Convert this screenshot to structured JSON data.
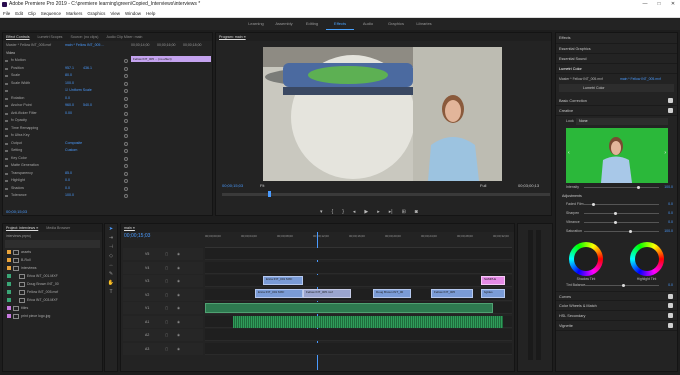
{
  "app": {
    "title": "Adobe Premiere Pro 2019 - C:\\premiere learning\\green\\Copied_Interviews\\interviews *",
    "win_min": "—",
    "win_max": "□",
    "win_close": "✕"
  },
  "menu": [
    "File",
    "Edit",
    "Clip",
    "Sequence",
    "Markers",
    "Graphics",
    "View",
    "Window",
    "Help"
  ],
  "workspaces": [
    {
      "label": "Learning"
    },
    {
      "label": "Assembly"
    },
    {
      "label": "Editing"
    },
    {
      "label": "Effects",
      "active": true
    },
    {
      "label": "Audio"
    },
    {
      "label": "Graphics"
    },
    {
      "label": "Libraries"
    }
  ],
  "effect_controls": {
    "tabs": [
      "Effect Controls",
      "Lumetri Scopes",
      "Source: (no clips)",
      "Audio Clip Mixer: main"
    ],
    "master": "Master * Fellow INT_005.mxf",
    "clip": "main * Fellow INT_005 ...",
    "timecodes": [
      "00;00;14;00",
      "00;00;16;00",
      "00;00;18;00"
    ],
    "clip_bar": "Fellow INT_005 ... (no effect)",
    "section_video": "Video",
    "rows": [
      {
        "label": "fx Motion",
        "indent": 0
      },
      {
        "label": "Position",
        "v": "957.1",
        "v2": "436.1"
      },
      {
        "label": "Scale",
        "v": "80.0"
      },
      {
        "label": "Scale Width",
        "v": "100.0"
      },
      {
        "label": "",
        "v": "☑ Uniform Scale"
      },
      {
        "label": "Rotation",
        "v": "0.0"
      },
      {
        "label": "Anchor Point",
        "v": "960.0",
        "v2": "540.0"
      },
      {
        "label": "Anti-flicker Filter",
        "v": "0.00"
      },
      {
        "label": "fx Opacity"
      },
      {
        "label": "Time Remapping"
      },
      {
        "label": "fx Ultra Key"
      },
      {
        "label": "Output",
        "v": "Composite"
      },
      {
        "label": "Setting",
        "v": "Custom"
      },
      {
        "label": "Key Color",
        "v": ""
      },
      {
        "label": "Matte Generation"
      },
      {
        "label": "Transparency",
        "v": "85.0"
      },
      {
        "label": "Highlight",
        "v": "0.0"
      },
      {
        "label": "Shadow",
        "v": "0.0"
      },
      {
        "label": "Tolerance",
        "v": "100.0"
      }
    ],
    "timecode_bottom": "00;00;15;03"
  },
  "program": {
    "title": "Program: main ≡",
    "timecode": "00;00;15;03",
    "fit": "Fit",
    "full": "Full",
    "duration": "00;03;00;13"
  },
  "lumetri": {
    "tabs": [
      "Effects",
      "Essential Graphics",
      "Essential Sound",
      "Lumetri Color"
    ],
    "master": "Master * Fellow INT_005.mxf",
    "clip": "main * Fellow INT_005.mxf",
    "effect": "Lumetri Color",
    "sections": {
      "basic": "Basic Correction",
      "creative": "Creative",
      "look_label": "Look",
      "look_value": "None",
      "intensity": "Intensity",
      "intensity_v": "100.0",
      "adjustments": "Adjustments",
      "faded": "Faded Film",
      "faded_v": "0.0",
      "sharpen": "Sharpen",
      "sharpen_v": "0.0",
      "vibrance": "Vibrance",
      "vibrance_v": "0.0",
      "saturation": "Saturation",
      "saturation_v": "100.0",
      "shadow_tint": "Shadow Tint",
      "highlight_tint": "Highlight Tint",
      "tint_balance": "Tint Balance",
      "tint_balance_v": "0.0",
      "curves": "Curves",
      "color_wheels": "Color Wheels & Match",
      "hsl": "HSL Secondary",
      "vignette": "Vignette"
    }
  },
  "project": {
    "tabs": [
      "Project: interviews ≡",
      "Media Browser"
    ],
    "file": "interviews.prproj",
    "items": [
      {
        "label": "assets",
        "color": "#e8a33a"
      },
      {
        "label": "B-Roll",
        "color": "#e8a33a"
      },
      {
        "label": "interviews",
        "color": "#e8a33a"
      },
      {
        "label": "Erica INT_001.MXF",
        "color": "#3aa676"
      },
      {
        "label": "Doug Brown INT_00",
        "color": "#3aa676"
      },
      {
        "label": "Fellow INT_005.mxf",
        "color": "#3aa676"
      },
      {
        "label": "Erica INT_003.MXF",
        "color": "#3aa676"
      },
      {
        "label": "titles",
        "color": "#c87ae0"
      },
      {
        "label": "print piece logo.jpg",
        "color": "#c87ae0"
      }
    ]
  },
  "timeline": {
    "tab": "main ≡",
    "timecode": "00;00;15;03",
    "ruler": [
      "00;00;00;00",
      "00;00;04;00",
      "00;00;08;00",
      "00;00;12;00",
      "00;00;16;00",
      "00;00;20;00",
      "00;00;24;00",
      "00;00;28;00",
      "00;00;32;00"
    ],
    "tracks_v": [
      "V5",
      "V4",
      "V3",
      "V2",
      "V1"
    ],
    "tracks_a": [
      "A1",
      "A2",
      "A3"
    ],
    "clips": [
      {
        "label": "Montages",
        "color": "pink"
      },
      {
        "label": "Erica INT_001 MXF",
        "color": "blue"
      },
      {
        "label": "Fellow INT_005.mxf",
        "color": "lav"
      },
      {
        "label": "Doug",
        "color": "pink"
      },
      {
        "label": "Doug Brown INT_00",
        "color": "blue"
      },
      {
        "label": "Fellow",
        "color": "pink"
      },
      {
        "label": "Fellow INT_005",
        "color": "blue"
      },
      {
        "label": "SAMPLE",
        "color": "pink"
      },
      {
        "label": "bgtiles",
        "color": "blue"
      },
      {
        "label": "Kiwi green fin adjustment-lever - 51",
        "color": "blue"
      }
    ]
  }
}
